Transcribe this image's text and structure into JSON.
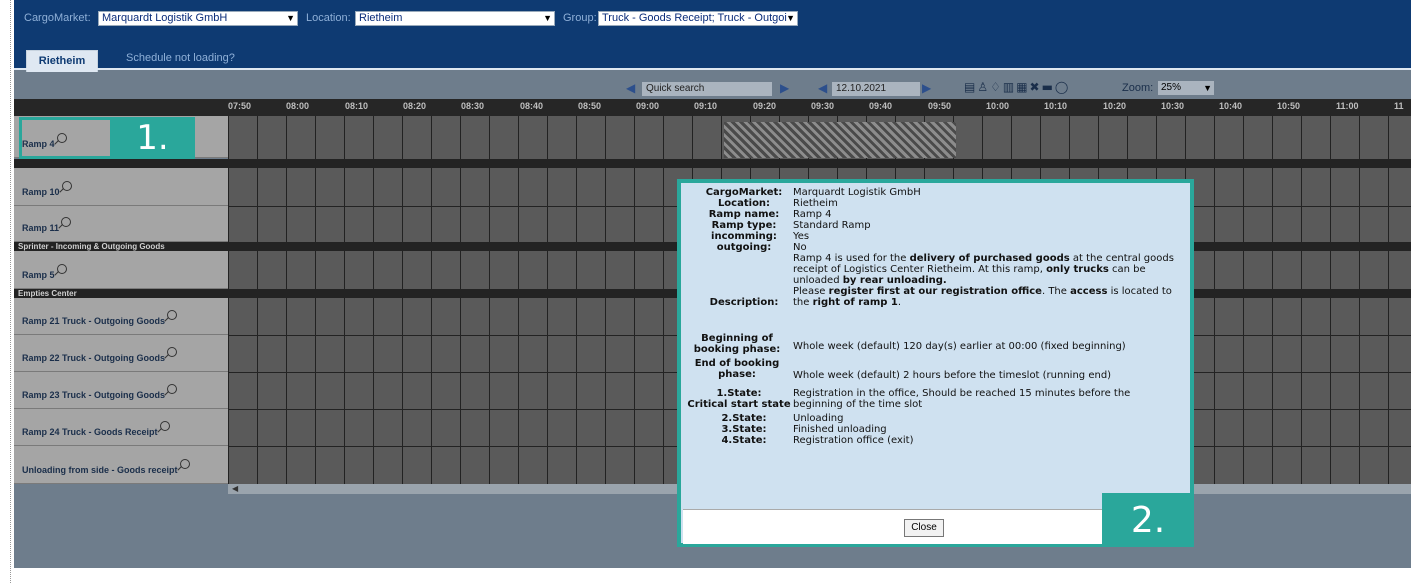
{
  "filters": {
    "cargomarket_label": "CargoMarket:",
    "cargomarket_value": "Marquardt Logistik GmbH",
    "location_label": "Location:",
    "location_value": "Rietheim",
    "group_label": "Group:",
    "group_value": "Truck - Goods Receipt; Truck - Outgoi"
  },
  "tabs": {
    "active": "Rietheim",
    "link": "Schedule not loading?"
  },
  "toolbar": {
    "quick_search": "Quick search",
    "date": "12.10.2021",
    "zoom_label": "Zoom:",
    "zoom_value": "25%"
  },
  "times": [
    "07:50",
    "08:00",
    "08:10",
    "08:20",
    "08:30",
    "08:40",
    "08:50",
    "09:00",
    "09:10",
    "09:20",
    "09:30",
    "09:40",
    "09:50",
    "10:00",
    "10:10",
    "10:20",
    "10:30",
    "10:40",
    "10:50",
    "11:00",
    "11"
  ],
  "groups": {
    "sprinter": "Sprinter - Incoming & Outgoing Goods",
    "empties": "Empties Center"
  },
  "rows": {
    "ramp4": "Ramp 4",
    "ramp10": "Ramp 10",
    "ramp11": "Ramp 11",
    "ramp5": "Ramp 5",
    "ramp21": "Ramp 21 Truck - Outgoing Goods",
    "ramp22": "Ramp 22 Truck - Outgoing Goods",
    "ramp23": "Ramp 23 Truck - Outgoing Goods",
    "ramp24": "Ramp 24 Truck - Goods Receipt",
    "side": "Unloading from side - Goods receipt"
  },
  "callouts": {
    "one": "1.",
    "two": "2."
  },
  "popup": {
    "cargomarket_k": "CargoMarket:",
    "cargomarket_v": "Marquardt Logistik GmbH",
    "location_k": "Location:",
    "location_v": "Rietheim",
    "ramp_name_k": "Ramp name:",
    "ramp_name_v": "Ramp 4",
    "ramp_type_k": "Ramp type:",
    "ramp_type_v": "Standard Ramp",
    "incoming_k": "incomming:",
    "incoming_v": "Yes",
    "outgoing_k": "outgoing:",
    "outgoing_v": "No",
    "description_k": "Description:",
    "desc": {
      "p1": "Ramp 4 is used for the ",
      "b1": "delivery of purchased goods",
      "p2": " at the central goods receipt of Logistics Center Rietheim. At this ramp, ",
      "b2": "only trucks",
      "p3": " can be unloaded ",
      "b3": "by rear unloading.",
      "p4": "Please ",
      "b4": "register first at our registration office",
      "p5": ". The ",
      "b5": "access",
      "p6": " is located to the ",
      "b6": "right of ramp 1",
      "p7": "."
    },
    "begin_k": "Beginning of booking phase:",
    "begin_v": "Whole week (default) 120 day(s) earlier at 00:00 (fixed beginning)",
    "end_k": "End of booking phase:",
    "end_v": "Whole week (default) 2 hours before the timeslot (running end)",
    "state1_k": "1.State:",
    "state1_k2": "Critical start state",
    "state1_v": "Registration in the office, Should be reached 15 minutes before the beginning of the time slot",
    "state2_k": "2.State:",
    "state2_v": "Unloading",
    "state3_k": "3.State:",
    "state3_v": "Finished unloading",
    "state4_k": "4.State:",
    "state4_v": "Registration office (exit)",
    "close": "Close"
  }
}
